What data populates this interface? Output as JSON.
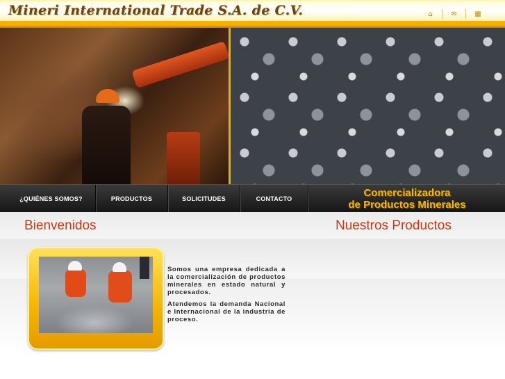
{
  "header": {
    "logo_text": "Mineri International Trade S.A. de C.V.",
    "icons": [
      {
        "name": "home-icon",
        "glyph": "⌂"
      },
      {
        "name": "mail-icon",
        "glyph": "✉"
      },
      {
        "name": "sitemap-icon",
        "glyph": "▦"
      }
    ]
  },
  "nav": {
    "items": [
      {
        "label": "¿QUIÉNES SOMOS?"
      },
      {
        "label": "PRODUCTOS"
      },
      {
        "label": "SOLICITUDES"
      },
      {
        "label": "CONTACTO"
      }
    ],
    "brand_line1": "Comercializadora",
    "brand_line2": "de Productos Minerales"
  },
  "main": {
    "welcome_title": "Bienvenidos",
    "products_title": "Nuestros Productos",
    "intro_p1": "Somos una empresa dedicada a la comercialización de productos minerales en estado natural y procesados.",
    "intro_p2": "Atendemos la demanda Nacional e Internacional de la industria de proceso."
  },
  "colors": {
    "accent": "#f5b400",
    "title_red": "#c83a14",
    "nav_bg": "#1f1f1f",
    "brand_text": "#f5b800"
  }
}
